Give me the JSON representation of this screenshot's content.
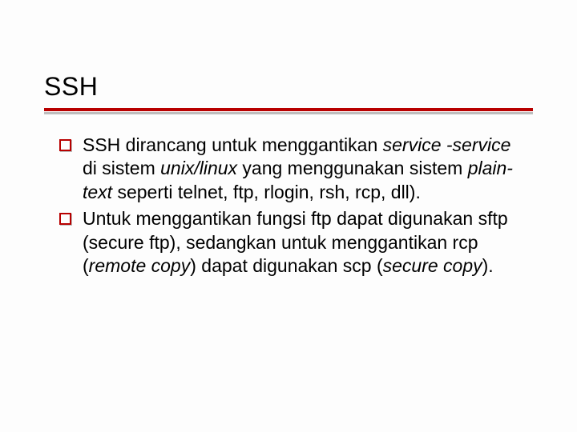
{
  "slide": {
    "title": "SSH",
    "bullets": [
      {
        "segments": [
          {
            "text": "SSH dirancang untuk menggantikan ",
            "italic": false
          },
          {
            "text": "service -service",
            "italic": true
          },
          {
            "text": " di sistem ",
            "italic": false
          },
          {
            "text": "unix/linux",
            "italic": true
          },
          {
            "text": " yang menggunakan sistem ",
            "italic": false
          },
          {
            "text": "plain-text",
            "italic": true
          },
          {
            "text": " seperti telnet, ftp, rlogin, rsh, rcp, dll).",
            "italic": false
          }
        ]
      },
      {
        "segments": [
          {
            "text": "Untuk menggantikan fungsi ftp dapat digunakan sftp (secure ftp), sedangkan untuk menggantikan rcp (",
            "italic": false
          },
          {
            "text": "remote copy",
            "italic": true
          },
          {
            "text": ") dapat digunakan scp (",
            "italic": false
          },
          {
            "text": "secure copy",
            "italic": true
          },
          {
            "text": ").",
            "italic": false
          }
        ]
      }
    ]
  }
}
